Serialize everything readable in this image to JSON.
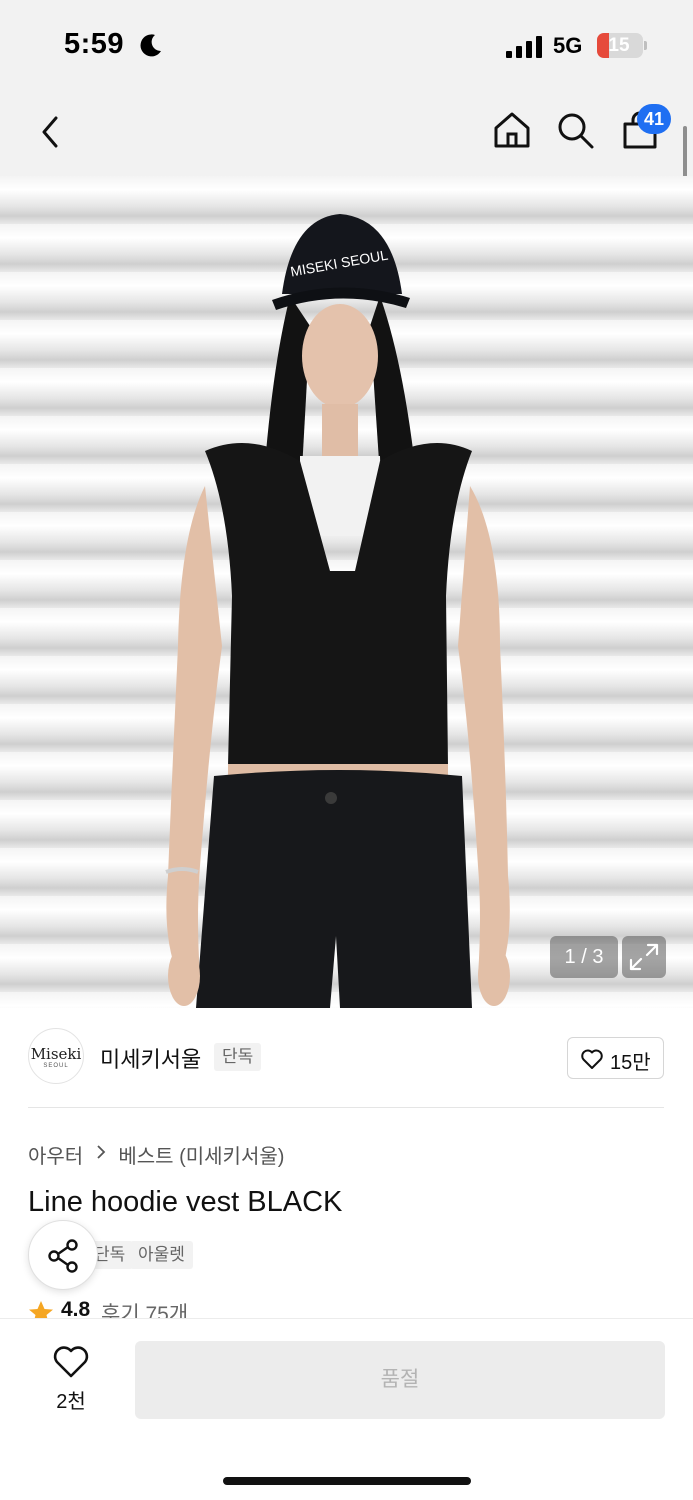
{
  "status_bar": {
    "time": "5:59",
    "network": "5G",
    "battery": "15"
  },
  "nav": {
    "cart_count": "41",
    "icons": [
      "back-icon",
      "home-icon",
      "search-icon",
      "shopping-bag-icon"
    ]
  },
  "gallery": {
    "counter": "1 / 3"
  },
  "brand": {
    "logo_main": "Miseki",
    "logo_sub": "SEOUL",
    "name": "미세키서울",
    "tag": "단독",
    "likes": "15만"
  },
  "product": {
    "breadcrumb": [
      "아우터",
      "베스트 (미세키서울)"
    ],
    "title": "Line hoodie vest BLACK",
    "tags": [
      "단독",
      "아울렛"
    ],
    "rating": "4.8",
    "reviews": "후기 75개"
  },
  "bottom": {
    "wish_count": "2천",
    "buy_label": "품절"
  },
  "colors": {
    "accent": "#1f6ff2",
    "star": "#f5a623",
    "battery_low": "#e64a3b"
  }
}
